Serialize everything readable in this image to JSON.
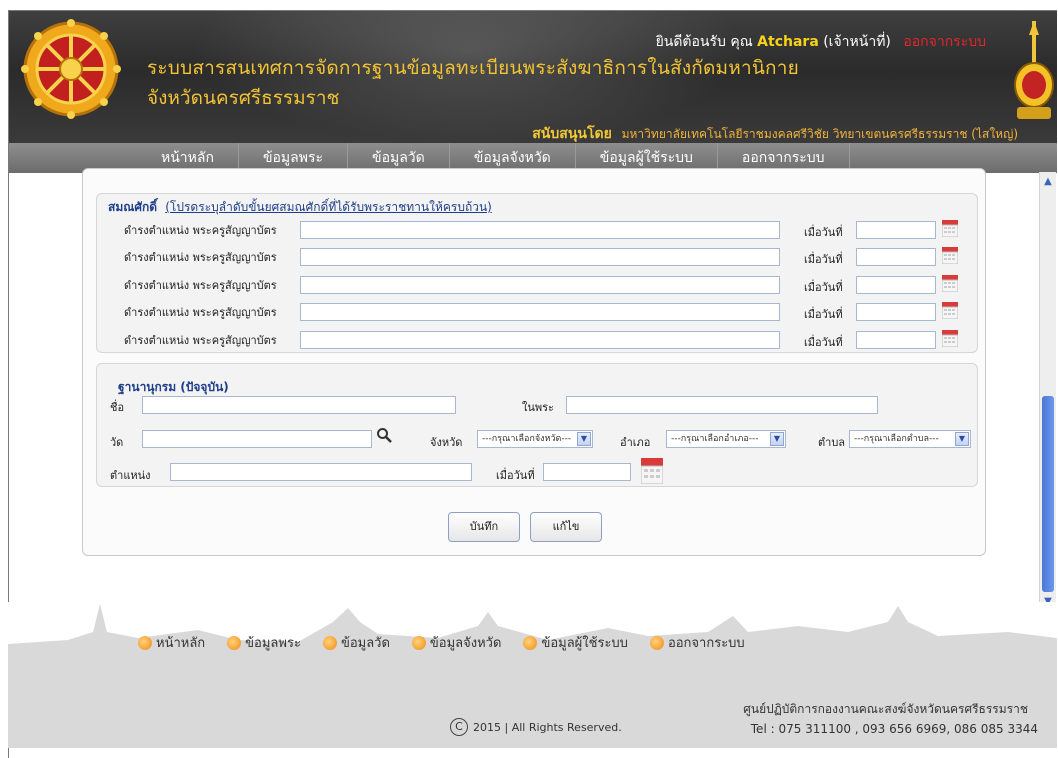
{
  "header": {
    "title_line1": "ระบบสารสนเทศการจัดการฐานข้อมูลทะเบียนพระสังฆาธิการในสังกัดมหานิกาย",
    "title_line2": "จังหวัดนครศรีธรรมราช",
    "welcome_prefix": "ยินดีต้อนรับ คุณ",
    "username": "Atchara",
    "role": "(เจ้าหน้าที่)",
    "logout": "ออกจากระบบ",
    "support_label": "สนับสนุนโดย",
    "support_org": "มหาวิทยาลัยเทคโนโลยีราชมงคลศรีวิชัย วิทยาเขตนครศรีธรรมราช (ไสใหญ่)"
  },
  "nav": {
    "items": [
      "หน้าหลัก",
      "ข้อมูลพระ",
      "ข้อมูลวัด",
      "ข้อมูลจังหวัด",
      "ข้อมูลผู้ใช้ระบบ",
      "ออกจากระบบ"
    ]
  },
  "form": {
    "section1_title": "สมณศักดิ์",
    "section1_note": "(โปรดระบุลำดับขั้นยศสมณศักดิ์ที่ได้รับพระราชทานให้ครบถ้วน)",
    "rank_label": "ดำรงตำแหน่ง พระครูสัญญาบัตร",
    "date_label": "เมื่อวันที่",
    "rank_rows": [
      "",
      "",
      "",
      "",
      ""
    ],
    "section2_title": "ฐานานุกรม (ปัจจุบัน)",
    "name_label": "ชื่อ",
    "in_label": "ในพระ",
    "temple_label": "วัด",
    "province_label": "จังหวัด",
    "province_select": "---กรุณาเลือกจังหวัด---",
    "district_label": "อำเภอ",
    "district_select": "---กรุณาเลือกอำเภอ---",
    "subdistrict_label": "ตำบล",
    "subdistrict_select": "---กรุณาเลือกตำบล---",
    "position_label": "ตำแหน่ง",
    "position_date_label": "เมื่อวันที่",
    "save_button": "บันทึก",
    "edit_button": "แก้ไข"
  },
  "footer": {
    "links": [
      "หน้าหลัก",
      "ข้อมูลพระ",
      "ข้อมูลวัด",
      "ข้อมูลจังหวัด",
      "ข้อมูลผู้ใช้ระบบ",
      "ออกจากระบบ"
    ],
    "copyright": "2015 | All Rights Reserved.",
    "contact_org": "ศูนย์ปฏิบัติการกองงานคณะสงฆ์จังหวัดนครศรีธรรมราช",
    "contact_tel": "Tel : 075 311100 , 093 656 6969, 086 085 3344"
  },
  "icons": {
    "logo": "dharma-wheel-icon",
    "crest": "university-crest-icon",
    "calendar": "calendar-icon",
    "search": "search-icon",
    "footer_bullet": "orange-bullet-icon"
  },
  "colors": {
    "title": "#f2c434",
    "username": "#f6d21a",
    "logout": "#e3262a",
    "legend": "#1f3e8a"
  }
}
